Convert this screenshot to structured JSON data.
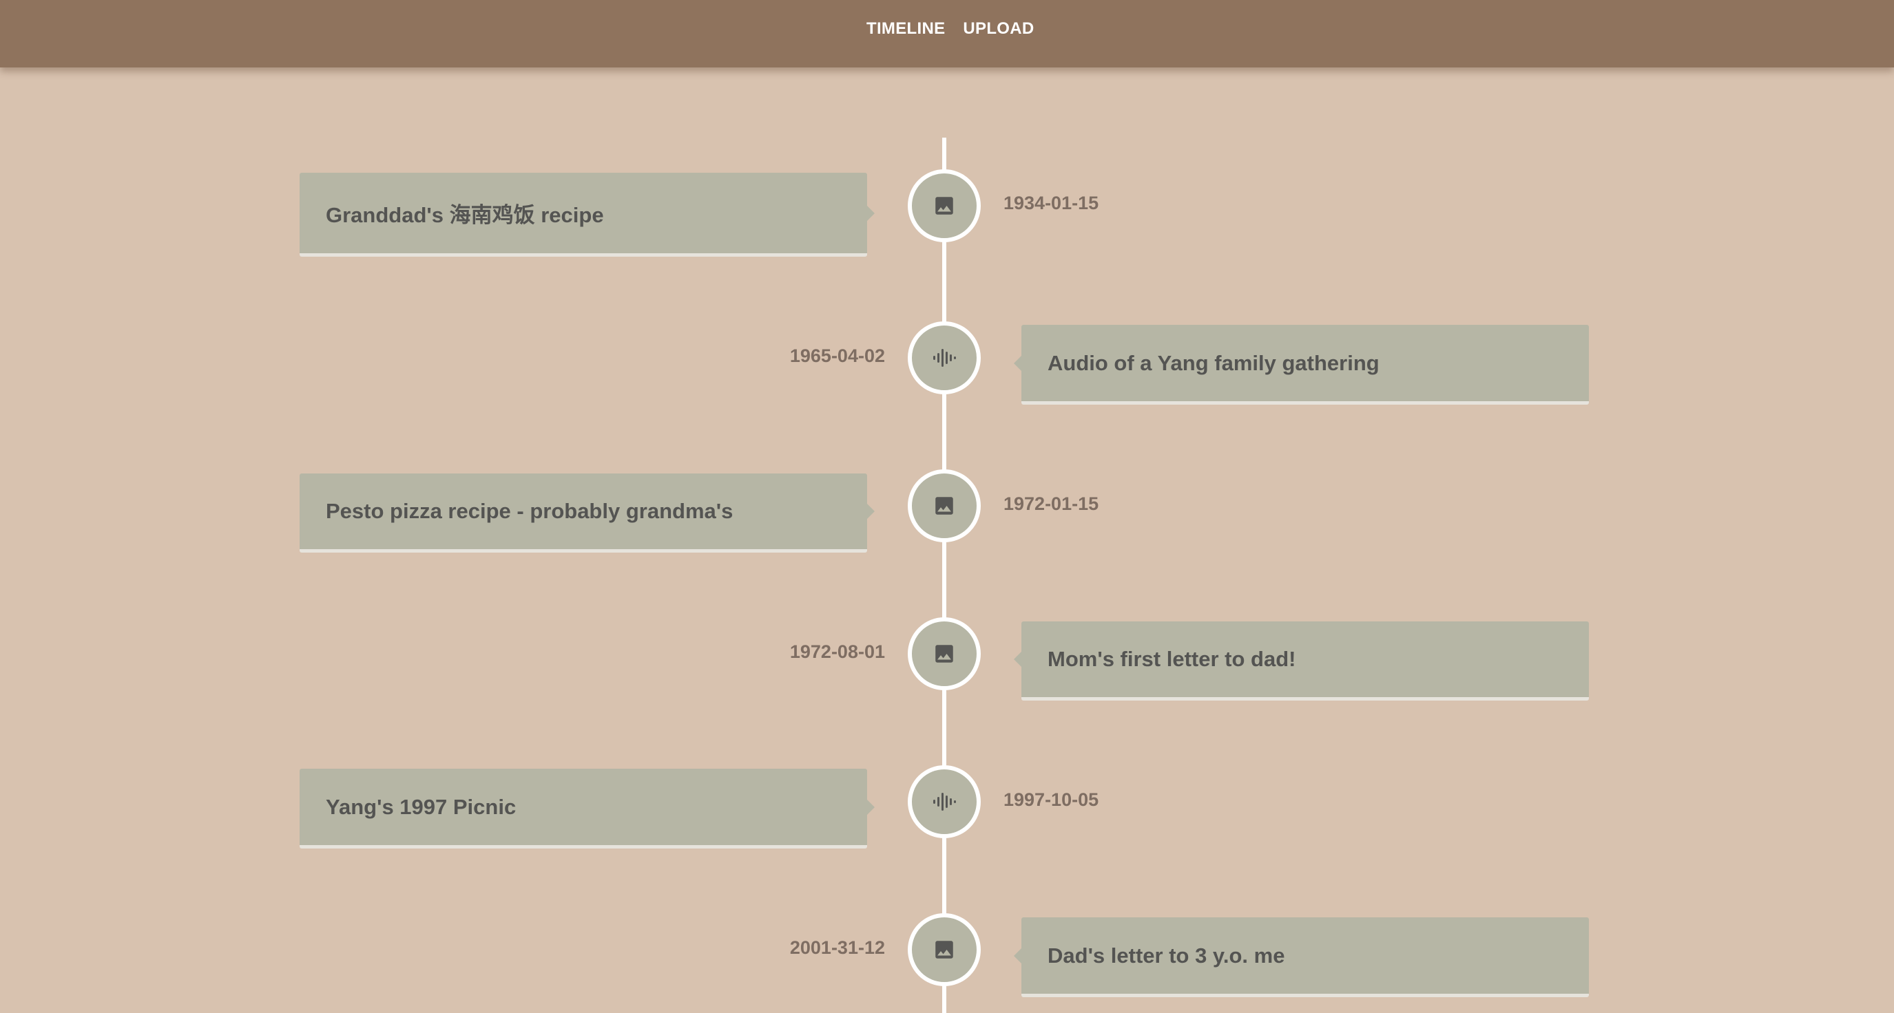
{
  "nav": {
    "timeline_label": "TIMELINE",
    "upload_label": "UPLOAD"
  },
  "colors": {
    "header": "#8f735d",
    "background": "#d8c2af",
    "card": "#b6b6a5",
    "line": "#ffffff",
    "date_text": "#7e6d62",
    "card_text": "#545452"
  },
  "events": [
    {
      "title": "Granddad's 海南鸡饭 recipe",
      "date": "1934-01-15",
      "icon": "image-icon",
      "side": "left"
    },
    {
      "title": "Audio of a Yang family gathering",
      "date": "1965-04-02",
      "icon": "audio-waveform-icon",
      "side": "right"
    },
    {
      "title": "Pesto pizza recipe - probably grandma's",
      "date": "1972-01-15",
      "icon": "image-icon",
      "side": "left"
    },
    {
      "title": "Mom's first letter to dad!",
      "date": "1972-08-01",
      "icon": "image-icon",
      "side": "right"
    },
    {
      "title": "Yang's 1997 Picnic",
      "date": "1997-10-05",
      "icon": "audio-waveform-icon",
      "side": "left"
    },
    {
      "title": "Dad's letter to 3 y.o. me",
      "date": "2001-31-12",
      "icon": "image-icon",
      "side": "right"
    }
  ]
}
